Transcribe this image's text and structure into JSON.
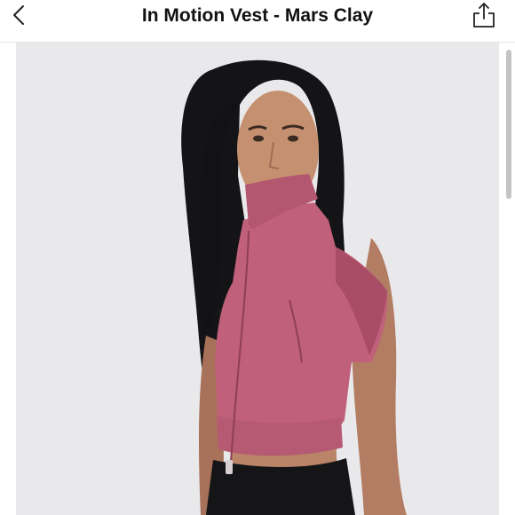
{
  "header": {
    "title": "In Motion Vest - Mars Clay",
    "back_icon": "chevron-left-icon",
    "share_icon": "share-icon"
  },
  "product": {
    "vest_color": "#c0607a",
    "background_color": "#e8e8ea"
  }
}
